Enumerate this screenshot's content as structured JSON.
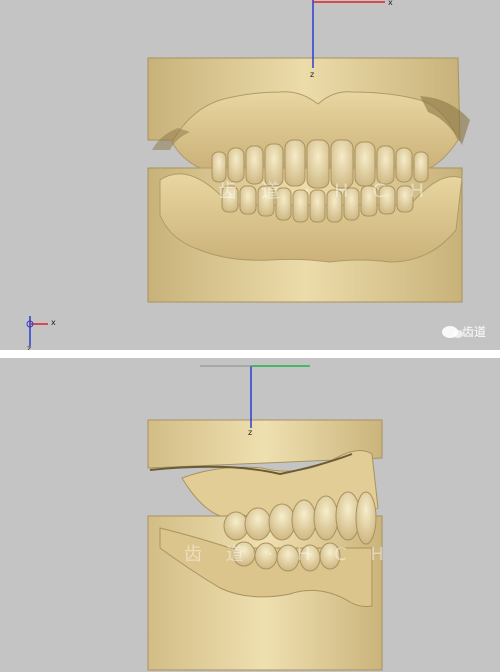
{
  "top_view": {
    "view": "front",
    "axis_z_label": "z",
    "axis_x_label": "x",
    "triad_z_label": "z",
    "triad_x_label": "x",
    "watermark": "齿 道 · H C H",
    "wechat_label": "齿道"
  },
  "bottom_view": {
    "view": "lateral",
    "axis_z_label": "z",
    "watermark": "齿 道 · H C H"
  },
  "colors": {
    "viewport_bg": "#c4c4c4",
    "model_base": "#e6d39e",
    "model_shade": "#c9b27a",
    "axis_x": "#e0202a",
    "axis_y": "#22b14c",
    "axis_z": "#2a3ecf"
  },
  "icons": [
    "wechat-icon",
    "axis-triad-icon"
  ]
}
